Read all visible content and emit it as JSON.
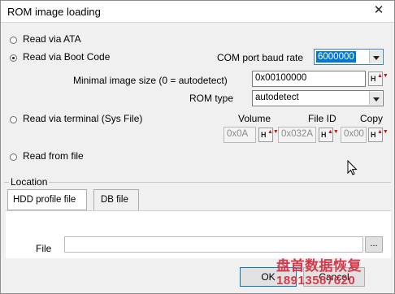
{
  "window": {
    "title": "ROM image loading",
    "close_symbol": "✕"
  },
  "read_options": {
    "ata": "Read via ATA",
    "boot_code": "Read via Boot Code",
    "terminal": "Read via terminal (Sys File)",
    "file": "Read from file",
    "selected": "boot_code"
  },
  "boot_code": {
    "baud_label": "COM port baud rate",
    "baud_value": "6000000",
    "min_size_label": "Minimal image size (0 = autodetect)",
    "min_size_value": "0x00100000",
    "rom_type_label": "ROM type",
    "rom_type_value": "autodetect"
  },
  "terminal": {
    "volume_label": "Volume",
    "volume_value": "0x0A",
    "file_id_label": "File ID",
    "file_id_value": "0x032A",
    "copy_label": "Copy",
    "copy_value": "0x00"
  },
  "spin_icon": {
    "hex": "H",
    "arrows": "▲▼"
  },
  "location": {
    "title": "Location",
    "tabs": [
      "HDD profile file",
      "DB file"
    ],
    "active_tab": 0,
    "file_label": "File",
    "file_value": "",
    "browse_label": "..."
  },
  "buttons": {
    "ok": "OK",
    "cancel": "Cancel"
  },
  "watermark": {
    "line1": "盘首数据恢复",
    "line2": "18913587620"
  },
  "colors": {
    "accent_selection": "#0078d7",
    "watermark": "#d63a4a"
  }
}
